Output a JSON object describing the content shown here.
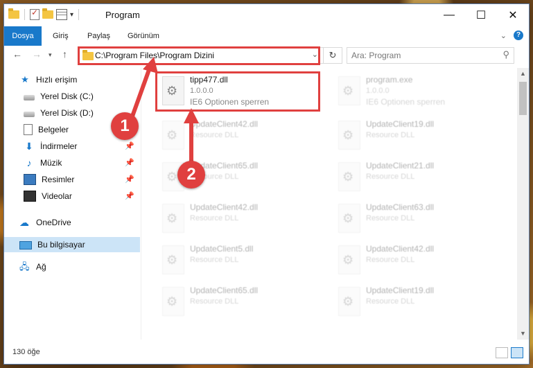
{
  "window": {
    "title": "Program"
  },
  "ribbon": {
    "tabs": [
      "Dosya",
      "Giriş",
      "Paylaş",
      "Görünüm"
    ]
  },
  "address": {
    "path": "C:\\Program Files\\Program Dizini"
  },
  "search": {
    "placeholder": "Ara: Program"
  },
  "nav": {
    "items": [
      {
        "label": "Hızlı erişim",
        "icon": "star-icon"
      },
      {
        "label": "Yerel Disk (C:)",
        "icon": "drive-icon"
      },
      {
        "label": "Yerel Disk (D:)",
        "icon": "drive-icon"
      },
      {
        "label": "Belgeler",
        "icon": "documents-icon"
      },
      {
        "label": "İndirmeler",
        "icon": "downloads-icon"
      },
      {
        "label": "Müzik",
        "icon": "music-icon"
      },
      {
        "label": "Resimler",
        "icon": "pictures-icon"
      },
      {
        "label": "Videolar",
        "icon": "videos-icon"
      },
      {
        "label": "OneDrive",
        "icon": "cloud-icon"
      },
      {
        "label": "Bu bilgisayar",
        "icon": "computer-icon",
        "selected": true
      },
      {
        "label": "Ağ",
        "icon": "network-icon"
      }
    ]
  },
  "files": [
    {
      "name": "tipp477.dll",
      "version": "1.0.0.0",
      "desc": "IE6 Optionen sperren",
      "highlight": true
    },
    {
      "name": "program.exe",
      "version": "1.0.0.0",
      "desc": "IE6 Optionen sperren"
    },
    {
      "name": "UpdateClient42.dll",
      "desc": "Resource DLL"
    },
    {
      "name": "UpdateClient19.dll",
      "desc": "Resource DLL"
    },
    {
      "name": "UpdateClient65.dll",
      "desc": "Resource DLL"
    },
    {
      "name": "UpdateClient21.dll",
      "desc": "Resource DLL"
    },
    {
      "name": "UpdateClient42.dll",
      "desc": "Resource DLL"
    },
    {
      "name": "UpdateClient63.dll",
      "desc": "Resource DLL"
    },
    {
      "name": "UpdateClient5.dll",
      "desc": "Resource DLL"
    },
    {
      "name": "UpdateClient42.dll",
      "desc": "Resource DLL"
    },
    {
      "name": "UpdateClient65.dll",
      "desc": "Resource DLL"
    },
    {
      "name": "UpdateClient19.dll",
      "desc": "Resource DLL"
    }
  ],
  "status": {
    "count": "130 öğe"
  },
  "annotations": {
    "step1": "1",
    "step2": "2"
  },
  "colors": {
    "accent": "#1979ca",
    "highlight_red": "#e0403f",
    "selected_bg": "#cce4f7"
  }
}
